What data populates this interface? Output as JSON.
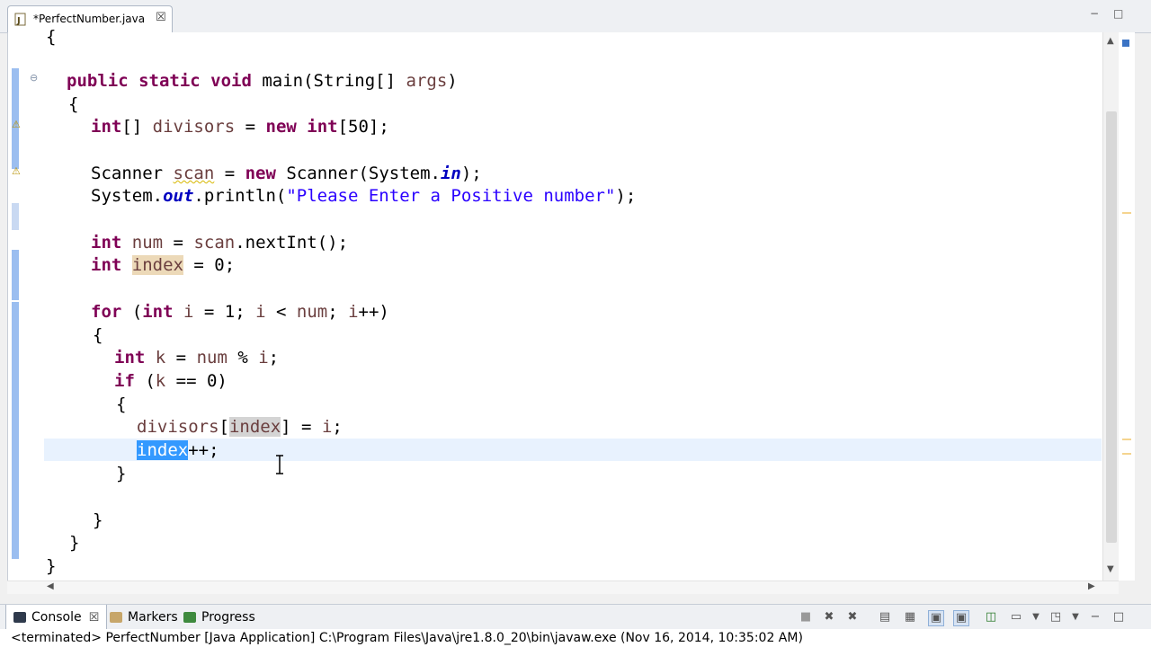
{
  "editor_tab": {
    "label": "*PerfectNumber.java",
    "close": "☒"
  },
  "window_controls": {
    "minimize": "−",
    "maximize": "□"
  },
  "code_lines": {
    "l0": "{",
    "l1_kw": "public static void",
    "l1_rest": " main(String[] ",
    "l1_var": "args",
    "l1_end": ")",
    "l2": "{",
    "l3_kw1": "int",
    "l3_a": "[] ",
    "l3_var": "divisors",
    "l3_b": " = ",
    "l3_kw2": "new int",
    "l3_c": "[50];",
    "l5_a": "Scanner ",
    "l5_var": "scan",
    "l5_b": " = ",
    "l5_kw": "new",
    "l5_c": " Scanner(System.",
    "l5_fld": "in",
    "l5_d": ");",
    "l6_a": "System.",
    "l6_fld": "out",
    "l6_b": ".println(",
    "l6_str": "\"Please Enter a Positive number\"",
    "l6_c": ");",
    "l8_kw": "int",
    "l8_a": " ",
    "l8_var1": "num",
    "l8_b": " = ",
    "l8_var2": "scan",
    "l8_c": ".nextInt();",
    "l9_kw": "int",
    "l9_a": " ",
    "l9_var": "index",
    "l9_b": " = 0;",
    "l11_kw": "for",
    "l11_a": " (",
    "l11_kw2": "int",
    "l11_b": " ",
    "l11_v1": "i",
    "l11_c": " = 1; ",
    "l11_v2": "i",
    "l11_d": " < ",
    "l11_v3": "num",
    "l11_e": "; ",
    "l11_v4": "i",
    "l11_f": "++)",
    "l12": "{",
    "l13_kw": "int",
    "l13_a": " ",
    "l13_v1": "k",
    "l13_b": " = ",
    "l13_v2": "num",
    "l13_c": " % ",
    "l13_v3": "i",
    "l13_d": ";",
    "l14_kw": "if",
    "l14_a": " (",
    "l14_v": "k",
    "l14_b": " == 0)",
    "l15": "{",
    "l16_v1": "divisors",
    "l16_a": "[",
    "l16_v2": "index",
    "l16_b": "] = ",
    "l16_v3": "i",
    "l16_c": ";",
    "l17_sel": "index",
    "l17_a": "++;",
    "l18": "}",
    "l20": "}",
    "l21": "}",
    "l22": "}"
  },
  "console": {
    "tabs": [
      {
        "label": "Console",
        "close": "☒"
      },
      {
        "label": "Markers"
      },
      {
        "label": "Progress"
      }
    ],
    "status": "<terminated> PerfectNumber [Java Application] C:\\Program Files\\Java\\jre1.8.0_20\\bin\\javaw.exe (Nov 16, 2014, 10:35:02 AM)"
  },
  "icons": {
    "java_file": "java-file-icon",
    "fold": "collapse-icon",
    "warning": "warning-icon",
    "text_cursor": "i-beam-cursor-icon"
  },
  "colors": {
    "keyword": "#7f0055",
    "variable": "#6a3e3e",
    "string": "#2a00ff",
    "static_field": "#0000c0",
    "selection": "#3399ff",
    "occurrence": "#ecd9b8",
    "current_line": "#e8f2fe"
  }
}
